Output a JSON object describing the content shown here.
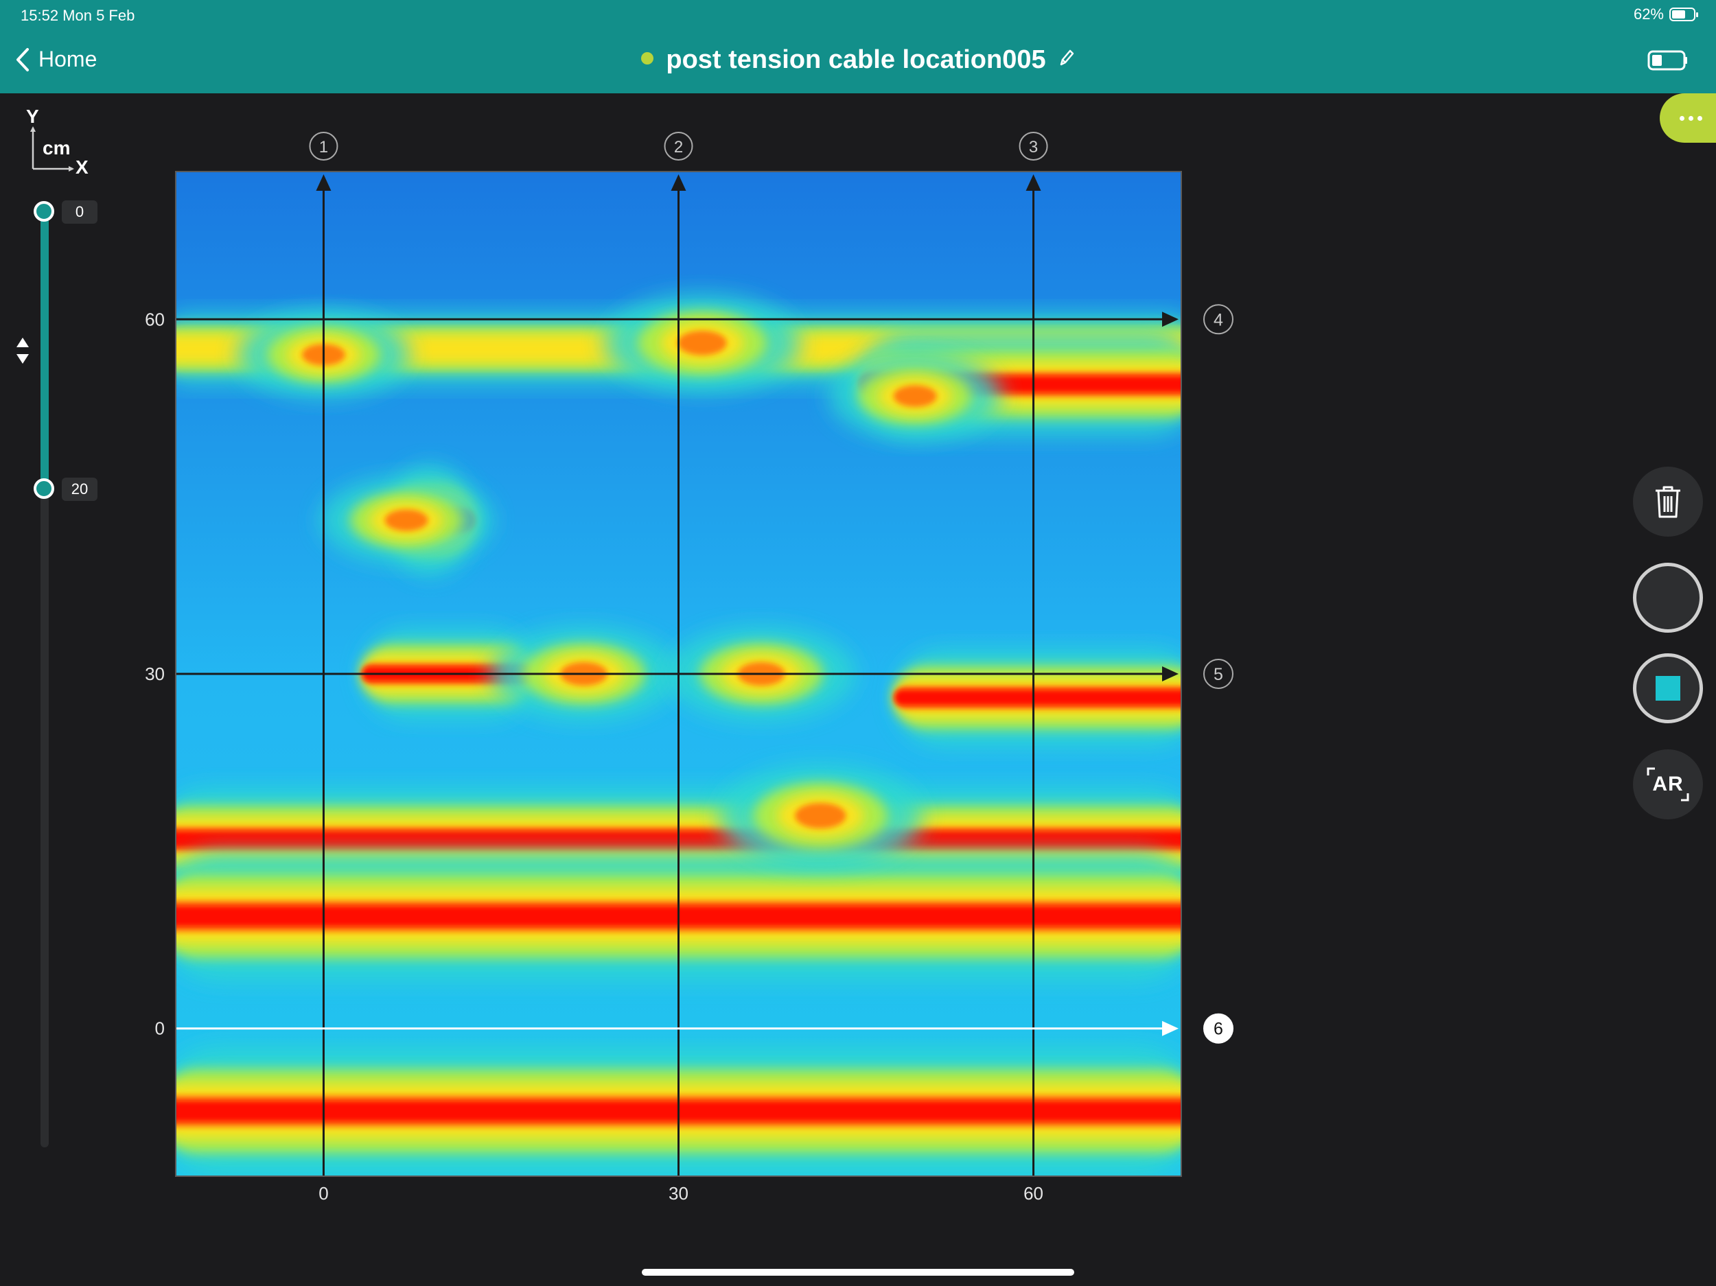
{
  "status_bar": {
    "time_date": "15:52   Mon 5 Feb",
    "battery": "62%",
    "battery_fraction": 0.62
  },
  "nav": {
    "back_label": "Home",
    "title": "post tension cable location005",
    "status_dot_color": "#b8d43a",
    "device_icon": "tablet-battery-icon"
  },
  "axis_indicator": {
    "y": "Y",
    "unit": "cm",
    "x": "X"
  },
  "depth_slider": {
    "top_value": "0",
    "bottom_value": "20"
  },
  "toolbar": {
    "more_icon": "more-horizontal-icon",
    "delete_icon": "trash-icon",
    "record_icon": "record-circle-icon",
    "stop_icon": "stop-square-icon",
    "ar_label": "AR",
    "stop_color": "#1cc4cf",
    "accent": "#b8d43a"
  },
  "chart_data": {
    "type": "heatmap",
    "title": "",
    "xlabel": "",
    "ylabel": "",
    "xlim": [
      -12.5,
      72.5
    ],
    "ylim": [
      -12.5,
      72.5
    ],
    "x_ticks": [
      "0",
      "30",
      "60"
    ],
    "y_ticks": [
      "60",
      "30",
      "0"
    ],
    "vertical_lines": [
      {
        "x": 0,
        "label": "1"
      },
      {
        "x": 30,
        "label": "2"
      },
      {
        "x": 60,
        "label": "3"
      }
    ],
    "horizontal_lines": [
      {
        "y": 60,
        "label": "4",
        "active": false
      },
      {
        "y": 30,
        "label": "5",
        "active": false
      },
      {
        "y": 0,
        "label": "6",
        "active": true
      }
    ],
    "bands": [
      {
        "y": 57.5,
        "x0": -12.5,
        "x1": 72.5,
        "strength": 0.55
      },
      {
        "y": 54.5,
        "x0": 47,
        "x1": 72.5,
        "strength": 0.8
      },
      {
        "y": 43,
        "x0": 7,
        "x1": 11,
        "strength": 0.85
      },
      {
        "y": 30,
        "x0": 5,
        "x1": 16,
        "strength": 0.7
      },
      {
        "y": 28,
        "x0": 50,
        "x1": 72.5,
        "strength": 0.75
      },
      {
        "y": 16,
        "x0": -12.5,
        "x1": 72.5,
        "strength": 0.8
      },
      {
        "y": 9.5,
        "x0": -12.5,
        "x1": 72.5,
        "strength": 1.0
      },
      {
        "y": -7,
        "x0": -12.5,
        "x1": 72.5,
        "strength": 1.0
      }
    ],
    "hotspots": [
      {
        "x": 0,
        "y": 57,
        "strength": 0.6
      },
      {
        "x": 32,
        "y": 58,
        "strength": 0.75
      },
      {
        "x": 7,
        "y": 43,
        "strength": 0.6
      },
      {
        "x": 22,
        "y": 30,
        "strength": 0.7
      },
      {
        "x": 37,
        "y": 30,
        "strength": 0.7
      },
      {
        "x": 42,
        "y": 18,
        "strength": 0.8
      },
      {
        "x": 50,
        "y": 53.5,
        "strength": 0.6
      }
    ]
  }
}
